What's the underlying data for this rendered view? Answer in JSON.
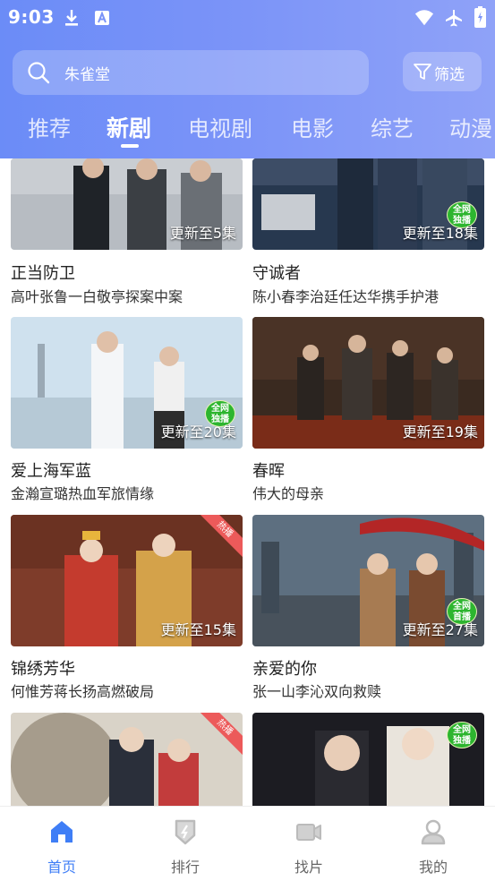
{
  "status_bar": {
    "time": "9:03"
  },
  "search": {
    "placeholder": "朱雀堂"
  },
  "filter": {
    "label": "筛选"
  },
  "tabs": [
    {
      "label": "推荐"
    },
    {
      "label": "新剧"
    },
    {
      "label": "电视剧"
    },
    {
      "label": "电影"
    },
    {
      "label": "综艺"
    },
    {
      "label": "动漫"
    }
  ],
  "active_tab": "新剧",
  "cards": [
    {
      "title": "正当防卫",
      "subtitle": "高叶张鲁一白敬亭探案中案",
      "update": "更新至5集",
      "badge": ""
    },
    {
      "title": "守诚者",
      "subtitle": "陈小春李治廷任达华携手护港",
      "update": "更新至18集",
      "badge": "全网独播"
    },
    {
      "title": "爱上海军蓝",
      "subtitle": "金瀚宣璐热血军旅情缘",
      "update": "更新至20集",
      "badge": "全网独播"
    },
    {
      "title": "春晖",
      "subtitle": "伟大的母亲",
      "update": "更新至19集",
      "badge": ""
    },
    {
      "title": "锦绣芳华",
      "subtitle": "何惟芳蒋长扬高燃破局",
      "update": "更新至15集",
      "badge": "热播"
    },
    {
      "title": "亲爱的你",
      "subtitle": "张一山李沁双向救赎",
      "update": "更新至27集",
      "badge": "全网首播"
    },
    {
      "title": "",
      "subtitle": "",
      "update": "",
      "badge": "热播"
    },
    {
      "title": "",
      "subtitle": "",
      "update": "",
      "badge": "全网独播"
    }
  ],
  "badges": {
    "exclusive_line1": "全网",
    "exclusive_line2": "独播",
    "premiere_line2": "首播",
    "hot": "热播"
  },
  "bottom_nav": [
    {
      "label": "首页",
      "icon": "home-icon",
      "active": true
    },
    {
      "label": "排行",
      "icon": "ranking-icon",
      "active": false
    },
    {
      "label": "找片",
      "icon": "video-camera-icon",
      "active": false
    },
    {
      "label": "我的",
      "icon": "user-icon",
      "active": false
    }
  ],
  "colors": {
    "header_start": "#6b8cf7",
    "header_end": "#8fa2f8",
    "accent": "#3f7ef6",
    "hot_badge": "#ec5a5a",
    "exclusive_badge": "#2db52f"
  }
}
